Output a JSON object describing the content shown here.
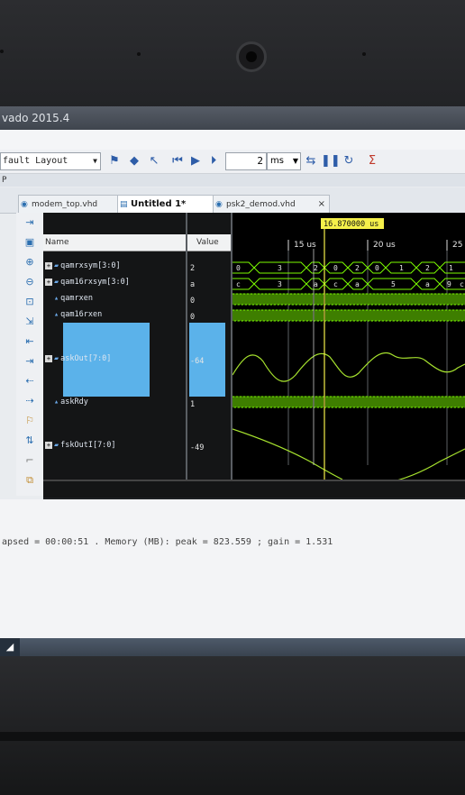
{
  "app": {
    "title_fragment": "vado 2015.4"
  },
  "toolbar": {
    "layout_select": "fault Layout",
    "time_value": "2",
    "time_unit": "ms"
  },
  "panel_strip": {
    "label": "P"
  },
  "tabs": [
    {
      "label": "modem_top.vhd",
      "icon": "vhdl-file-icon"
    },
    {
      "label": "Untitled 1*",
      "icon": "waveform-icon"
    },
    {
      "label": "psk2_demod.vhd",
      "icon": "vhdl-file-icon"
    }
  ],
  "wave": {
    "name_header": "Name",
    "value_header": "Value",
    "cursor_label": "16.870000 us",
    "time_ticks": [
      "15 us",
      "20 us",
      "25"
    ],
    "signals": [
      {
        "name": "qamrxsym[3:0]",
        "value": "2"
      },
      {
        "name": "qam16rxsym[3:0]",
        "value": "a"
      },
      {
        "name": "qamrxen",
        "value": "0"
      },
      {
        "name": "qam16rxen",
        "value": "0"
      },
      {
        "name": "askOut[7:0]",
        "value": "-64"
      },
      {
        "name": "askRdy",
        "value": "1"
      },
      {
        "name": "fskOutI[7:0]",
        "value": "-49"
      }
    ],
    "bus1_labels": [
      "0",
      "3",
      "2",
      "0",
      "2",
      "0",
      "1",
      "2",
      "1"
    ],
    "bus2_labels": [
      "c",
      "3",
      "a",
      "c",
      "a",
      "5",
      "a",
      "9",
      "c"
    ]
  },
  "status": {
    "message": "apsed = 00:00:51 . Memory (MB): peak = 823.559 ; gain = 1.531"
  },
  "colors": {
    "signal_green": "#7CFC00",
    "cursor_yellow": "#f5f04a",
    "selection_blue": "#5bb2ea"
  }
}
